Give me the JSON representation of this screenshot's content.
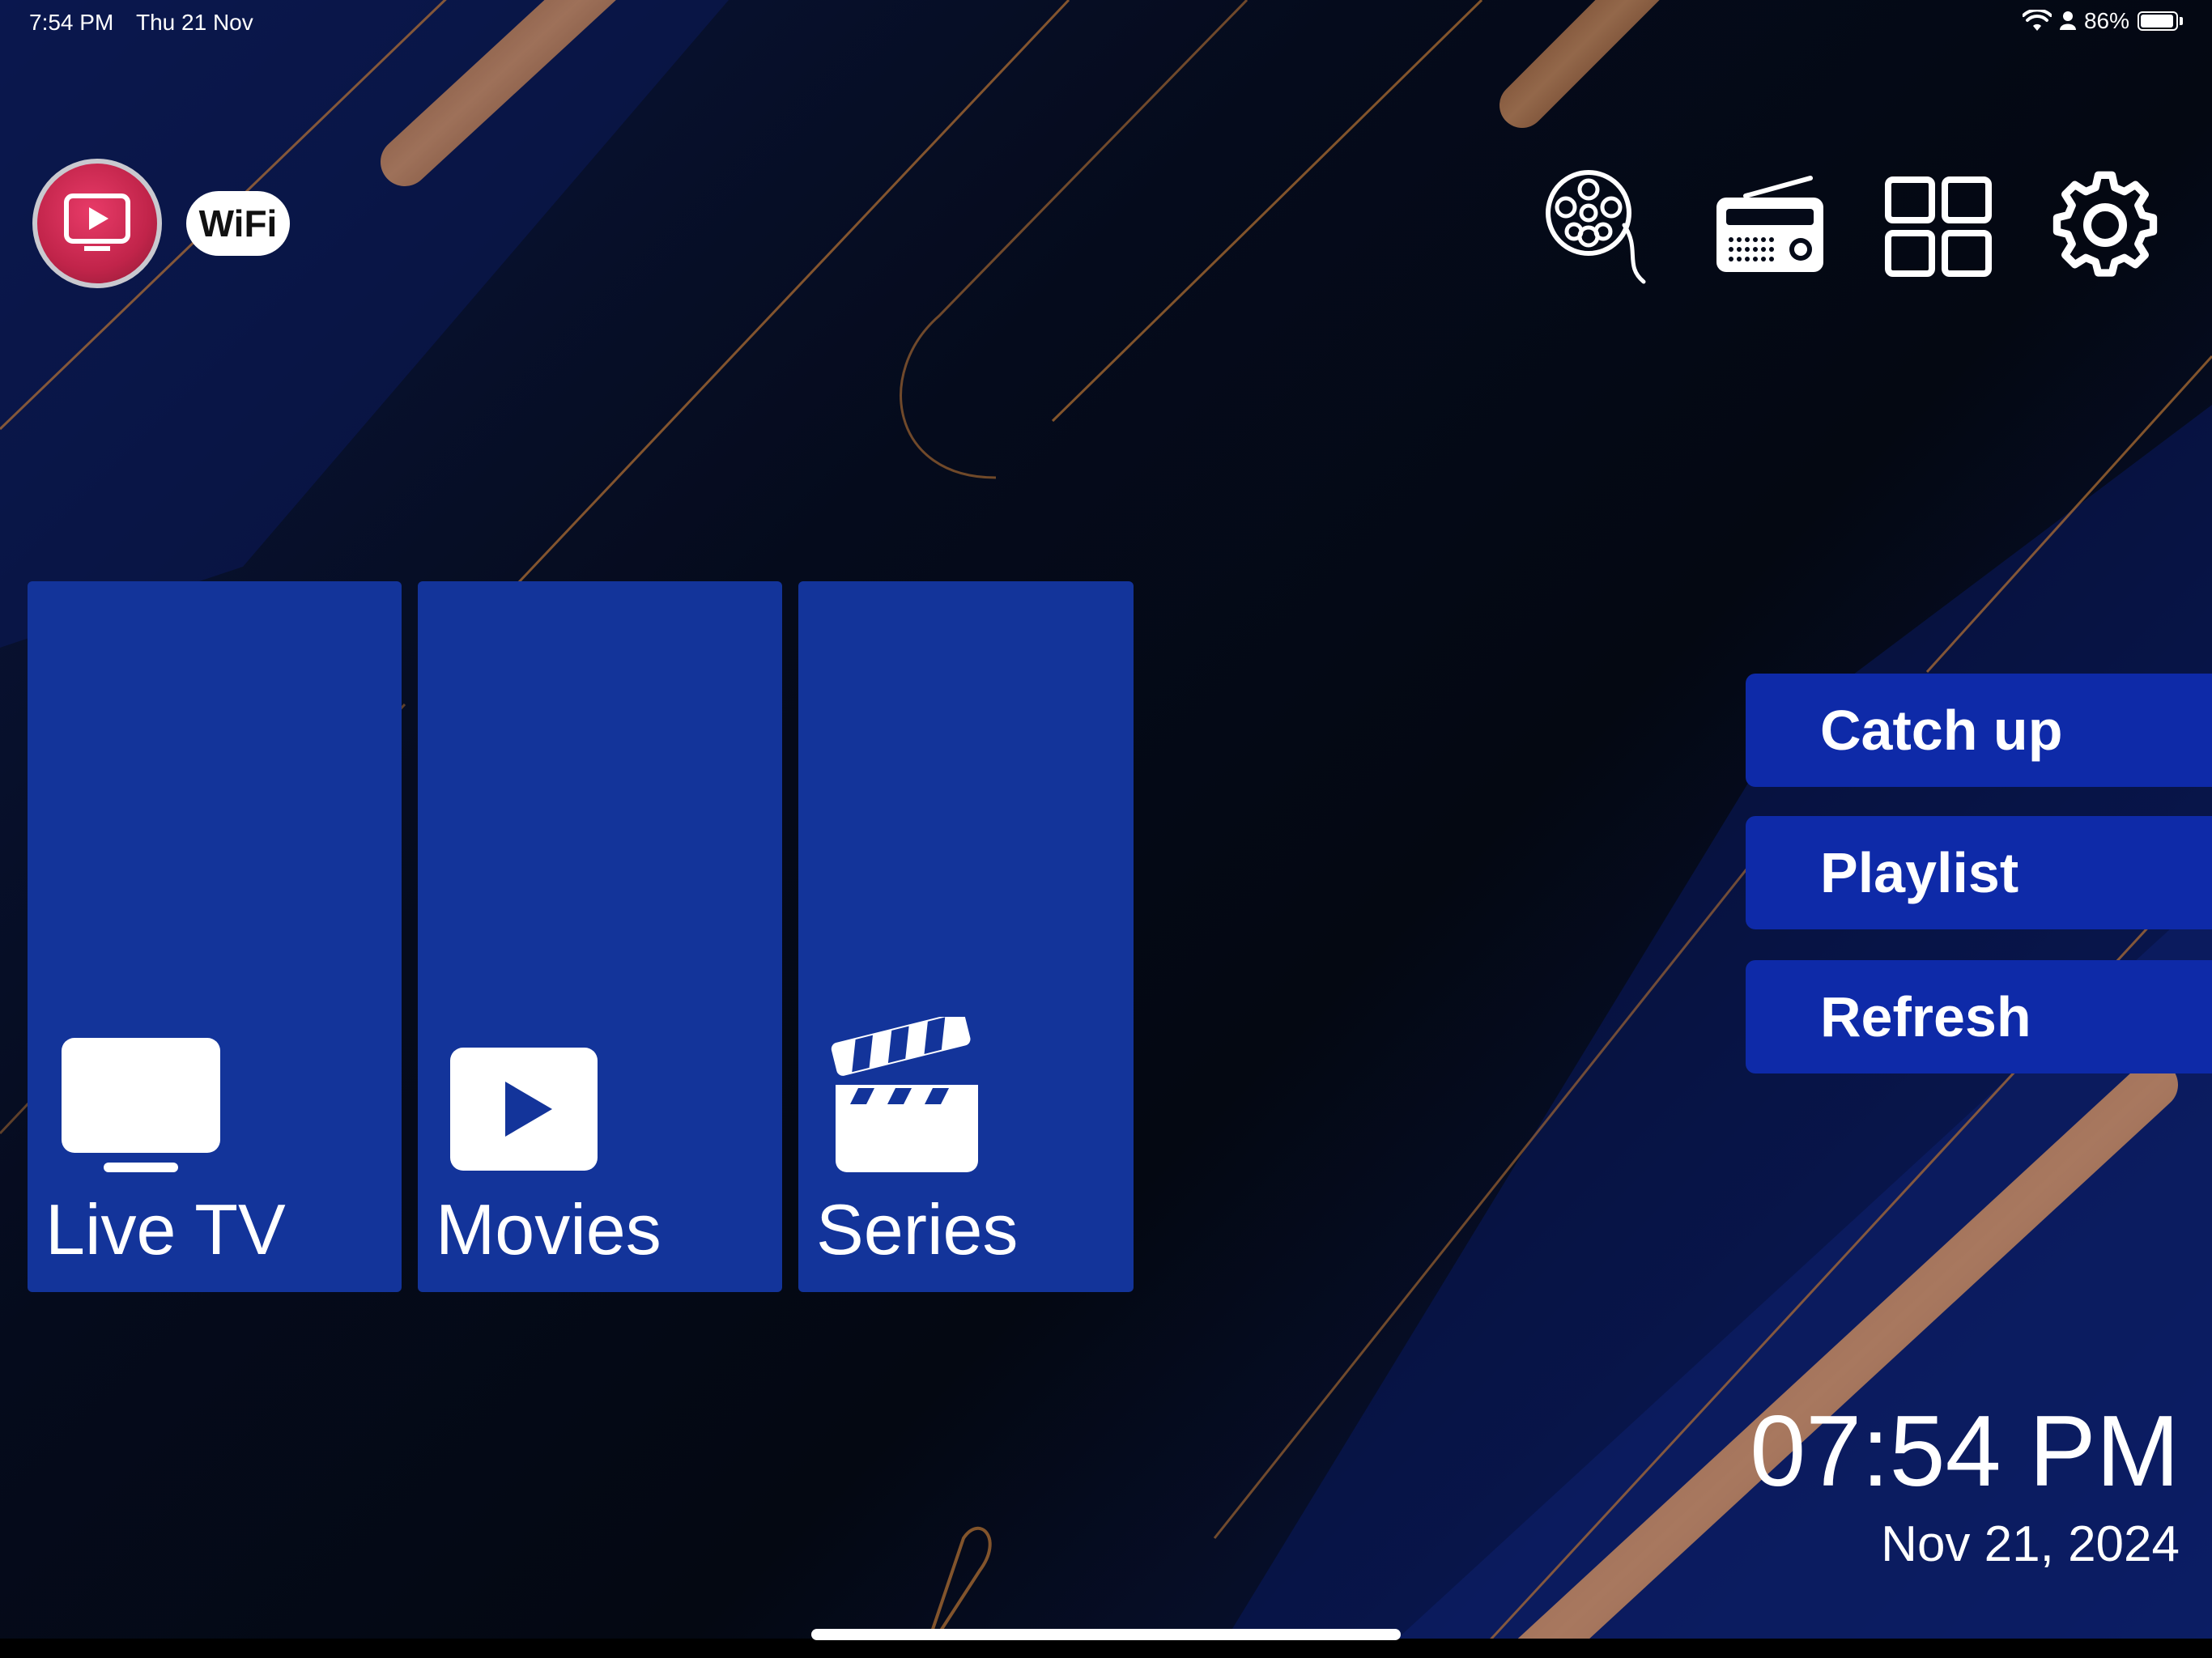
{
  "status_bar": {
    "time": "7:54 PM",
    "date": "Thu 21 Nov",
    "battery_text": "86%",
    "battery_level": 0.86,
    "icons": [
      "wifi-icon",
      "person-icon",
      "battery-icon"
    ]
  },
  "header": {
    "logo_icon": "play-screen-logo-icon",
    "wifi_badge_text": "WiFi",
    "actions": [
      {
        "name": "film-reel-icon"
      },
      {
        "name": "radio-icon"
      },
      {
        "name": "grid-icon"
      },
      {
        "name": "gear-icon"
      }
    ]
  },
  "tiles": [
    {
      "label": "Live TV",
      "icon": "tv-icon"
    },
    {
      "label": "Movies",
      "icon": "play-icon"
    },
    {
      "label": "Series",
      "icon": "clapperboard-icon"
    }
  ],
  "side_menu": {
    "catch_up": "Catch up",
    "playlist": "Playlist",
    "refresh": "Refresh"
  },
  "clock": {
    "time": "07:54 PM",
    "date": "Nov 21, 2024"
  },
  "colors": {
    "tile_blue": "#13349a",
    "button_blue": "#0e2aa8",
    "background_dark": "#050a18",
    "accent_copper": "#b87333",
    "logo_red": "#c1244a"
  }
}
